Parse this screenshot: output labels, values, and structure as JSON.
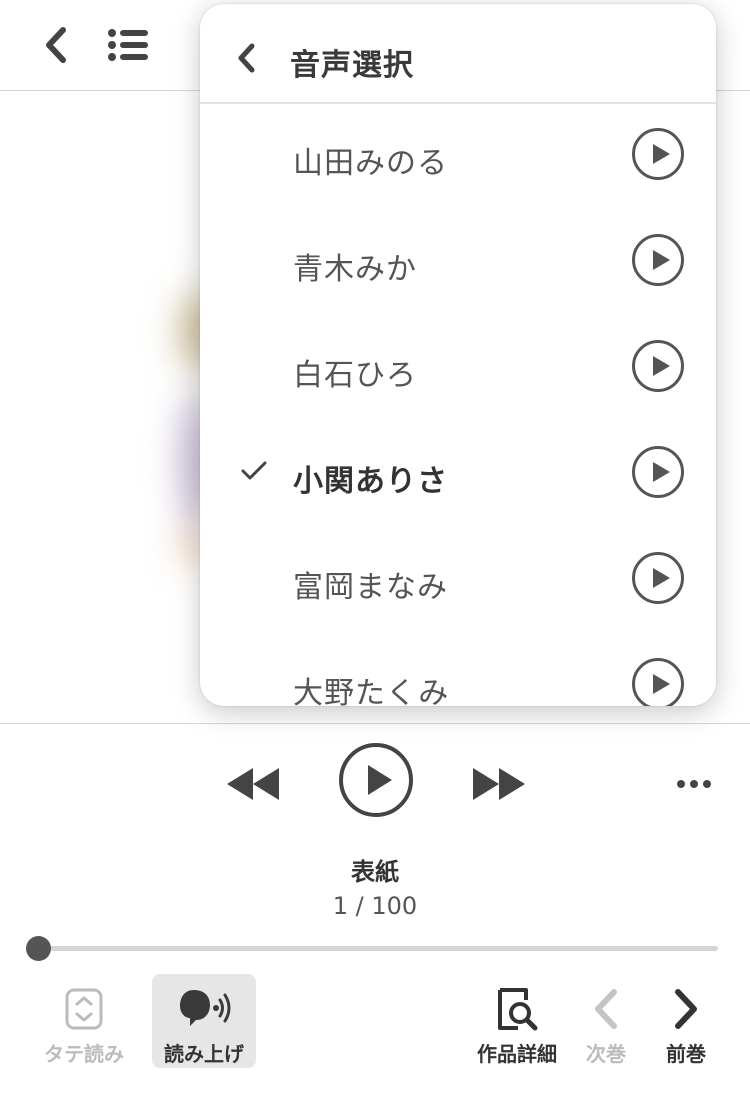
{
  "popup": {
    "title": "音声選択",
    "voices": [
      {
        "name": "山田みのる",
        "selected": false
      },
      {
        "name": "青木みか",
        "selected": false
      },
      {
        "name": "白石ひろ",
        "selected": false
      },
      {
        "name": "小関ありさ",
        "selected": true
      },
      {
        "name": "富岡まなみ",
        "selected": false
      },
      {
        "name": "大野たくみ",
        "selected": false
      }
    ]
  },
  "player": {
    "page_title": "表紙",
    "page_counter": "1 / 100",
    "progress_fraction": 0.0
  },
  "toolbar": {
    "vertical_read_label": "タテ読み",
    "read_aloud_label": "読み上げ",
    "work_details_label": "作品詳細",
    "next_volume_label": "次巻",
    "prev_volume_label": "前巻"
  },
  "icons": {
    "back": "chevron-left-icon",
    "toc": "list-icon",
    "rewind": "rewind-icon",
    "play": "play-icon",
    "fast_forward": "fast-forward-icon",
    "more": "more-icon"
  },
  "colors": {
    "text_dark": "#333333",
    "text_disabled": "#bbbbbb",
    "divider": "#d6d6d6",
    "active_background": "#e6e6e6"
  }
}
